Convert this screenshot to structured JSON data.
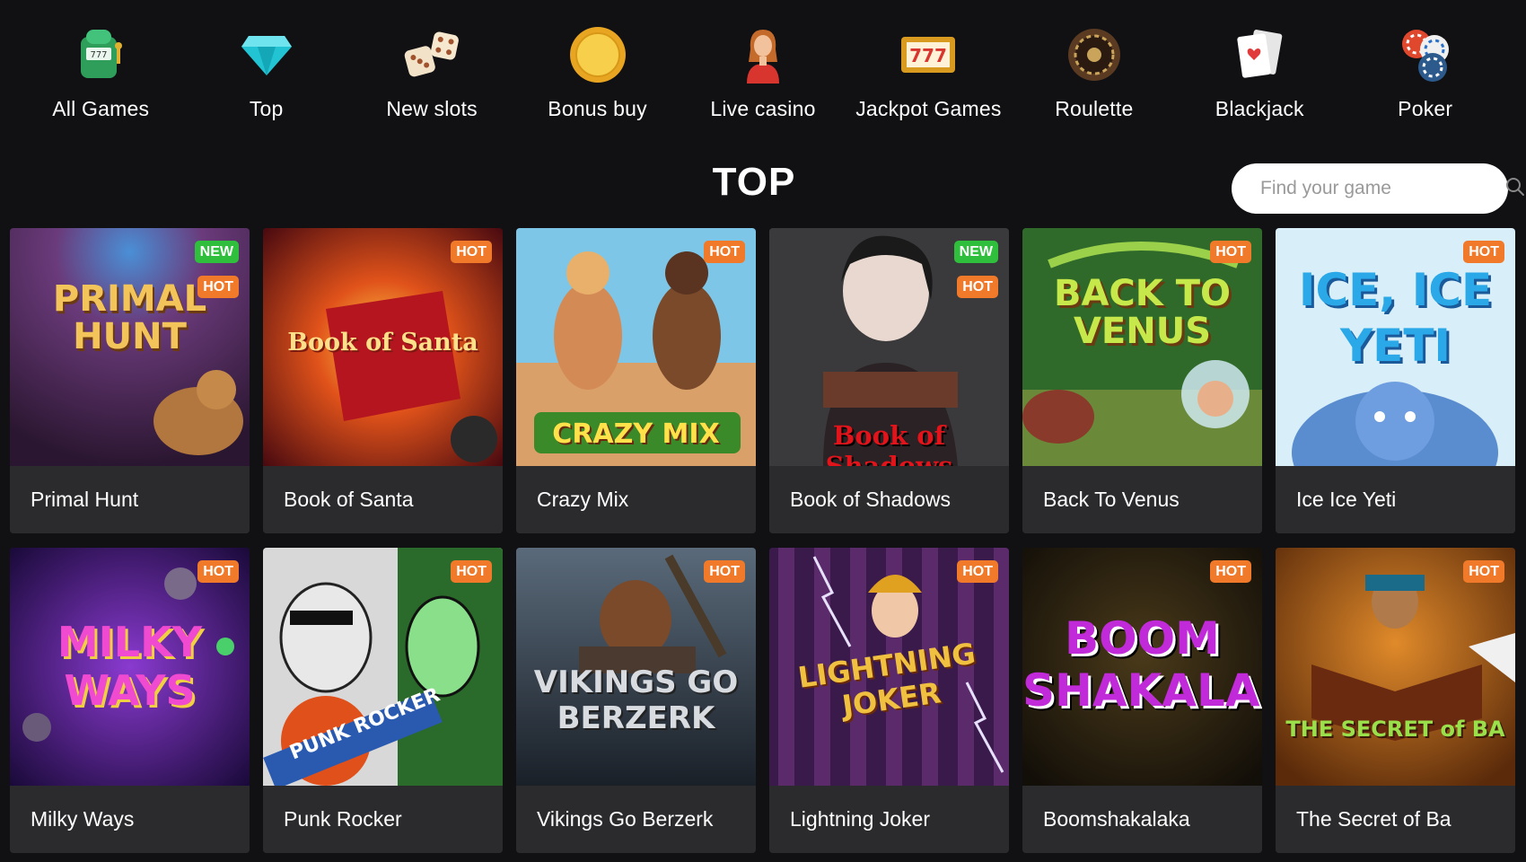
{
  "categories": [
    {
      "label": "All Games",
      "icon": "slot-machine-icon"
    },
    {
      "label": "Top",
      "icon": "diamond-icon"
    },
    {
      "label": "New slots",
      "icon": "dice-icon"
    },
    {
      "label": "Bonus buy",
      "icon": "gold-coin-icon"
    },
    {
      "label": "Live casino",
      "icon": "dealer-icon"
    },
    {
      "label": "Jackpot Games",
      "icon": "777-jackpot-icon"
    },
    {
      "label": "Roulette",
      "icon": "roulette-wheel-icon"
    },
    {
      "label": "Blackjack",
      "icon": "playing-cards-icon"
    },
    {
      "label": "Poker",
      "icon": "poker-chips-icon"
    }
  ],
  "section": {
    "title": "TOP"
  },
  "search": {
    "placeholder": "Find your game",
    "icon": "search-icon"
  },
  "badges": {
    "new": "NEW",
    "hot": "HOT"
  },
  "games": [
    {
      "name": "Primal Hunt",
      "art_text": "PRIMAL HUNT",
      "badges": [
        "NEW",
        "HOT"
      ]
    },
    {
      "name": "Book of Santa",
      "art_text": "Book of Santa",
      "badges": [
        "HOT"
      ]
    },
    {
      "name": "Crazy Mix",
      "art_text": "CRAZY MIX",
      "badges": [
        "HOT"
      ]
    },
    {
      "name": "Book of Shadows",
      "art_text": "Book of Shadows",
      "badges": [
        "NEW",
        "HOT"
      ]
    },
    {
      "name": "Back To Venus",
      "art_text": "BACK TO VENUS",
      "badges": [
        "HOT"
      ]
    },
    {
      "name": "Ice Ice Yeti",
      "art_text": "ICE, ICE YETI",
      "badges": [
        "HOT"
      ]
    },
    {
      "name": "Milky Ways",
      "art_text": "MILKY WAYS",
      "badges": [
        "HOT"
      ]
    },
    {
      "name": "Punk Rocker",
      "art_text": "PUNK ROCKER",
      "badges": [
        "HOT"
      ]
    },
    {
      "name": "Vikings Go Berzerk",
      "art_text": "VIKINGS GO BERZERK",
      "badges": [
        "HOT"
      ]
    },
    {
      "name": "Lightning Joker",
      "art_text": "LIGHTNING JOKER",
      "badges": [
        "HOT"
      ]
    },
    {
      "name": "Boomshakalaka",
      "art_text": "BOOM SHAKALAKA",
      "badges": [
        "HOT"
      ]
    },
    {
      "name": "The Secret of Ba",
      "art_text": "THE SECRET of BA",
      "badges": [
        "HOT"
      ]
    }
  ],
  "colors": {
    "background": "#111114",
    "card": "#2b2b2e",
    "badge_new": "#2fbf3c",
    "badge_hot": "#f07a2a"
  }
}
